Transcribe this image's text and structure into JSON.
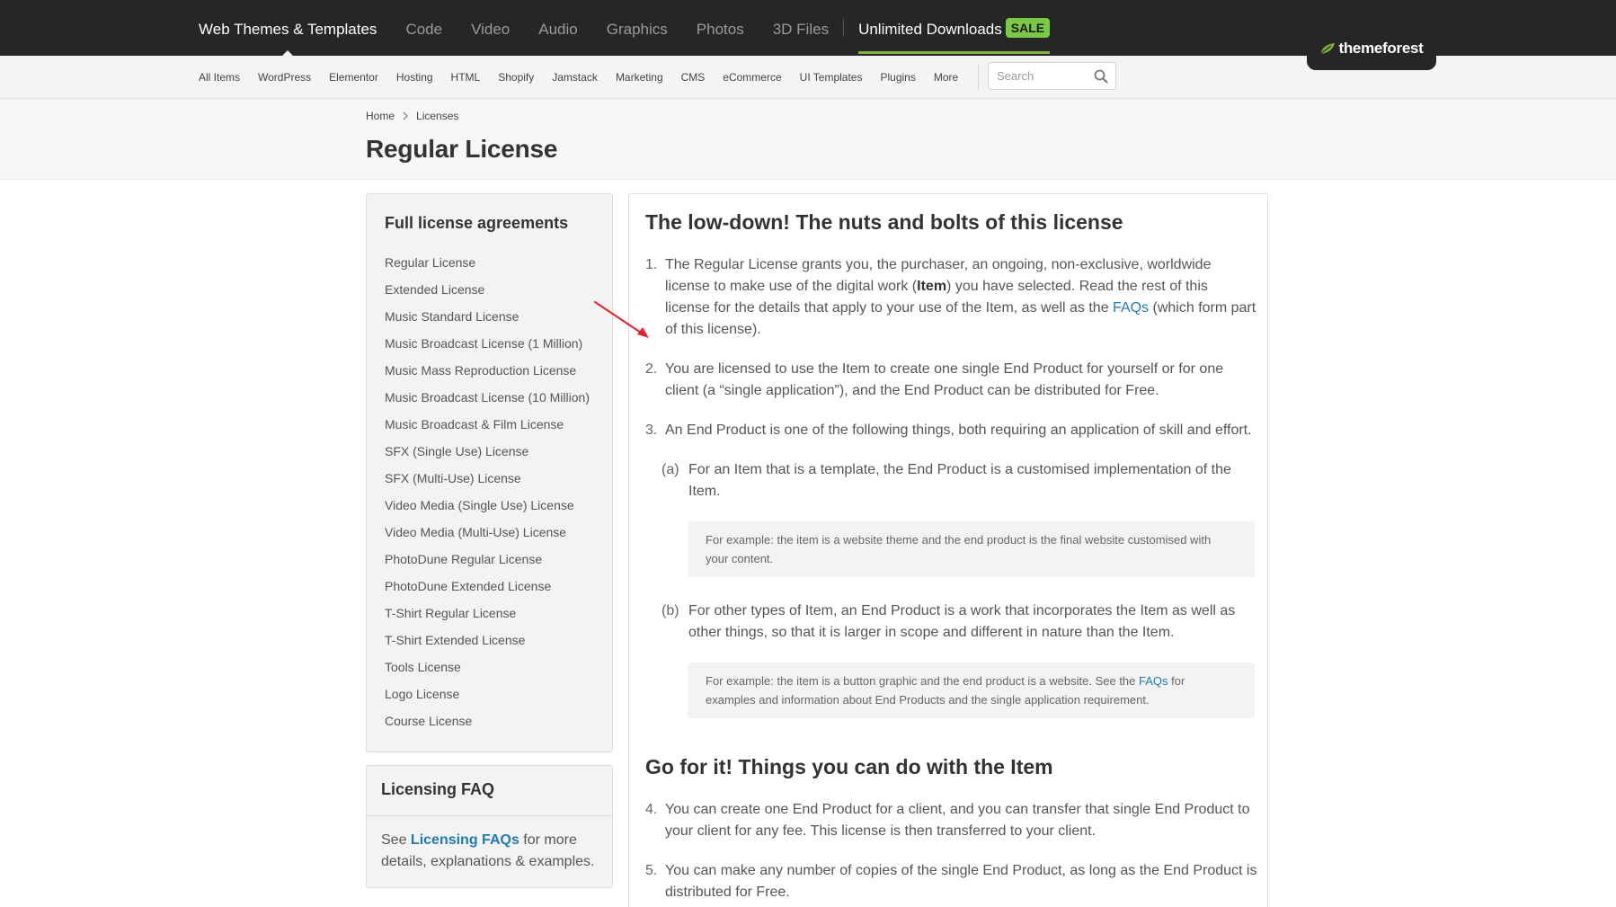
{
  "topnav": {
    "items": [
      {
        "label": "Web Themes & Templates"
      },
      {
        "label": "Code"
      },
      {
        "label": "Video"
      },
      {
        "label": "Audio"
      },
      {
        "label": "Graphics"
      },
      {
        "label": "Photos"
      },
      {
        "label": "3D Files"
      }
    ],
    "unlimited_label": "Unlimited Downloads",
    "sale_badge": "SALE",
    "logo_text": "themeforest",
    "accent_color": "#82b440"
  },
  "subnav": {
    "items": [
      {
        "label": "All Items"
      },
      {
        "label": "WordPress"
      },
      {
        "label": "Elementor"
      },
      {
        "label": "Hosting"
      },
      {
        "label": "HTML"
      },
      {
        "label": "Shopify"
      },
      {
        "label": "Jamstack"
      },
      {
        "label": "Marketing"
      },
      {
        "label": "CMS"
      },
      {
        "label": "eCommerce"
      },
      {
        "label": "UI Templates"
      },
      {
        "label": "Plugins"
      },
      {
        "label": "More"
      }
    ],
    "search_placeholder": "Search"
  },
  "breadcrumb": {
    "home": "Home",
    "current": "Licenses"
  },
  "page_title": "Regular License",
  "sidebar": {
    "title": "Full license agreements",
    "items": [
      {
        "label": "Regular License"
      },
      {
        "label": "Extended License"
      },
      {
        "label": "Music Standard License"
      },
      {
        "label": "Music Broadcast License (1 Million)"
      },
      {
        "label": "Music Mass Reproduction License"
      },
      {
        "label": "Music Broadcast License (10 Million)"
      },
      {
        "label": "Music Broadcast & Film License"
      },
      {
        "label": "SFX (Single Use) License"
      },
      {
        "label": "SFX (Multi-Use) License"
      },
      {
        "label": "Video Media (Single Use) License"
      },
      {
        "label": "Video Media (Multi-Use) License"
      },
      {
        "label": "PhotoDune Regular License"
      },
      {
        "label": "PhotoDune Extended License"
      },
      {
        "label": "T-Shirt Regular License"
      },
      {
        "label": "T-Shirt Extended License"
      },
      {
        "label": "Tools License"
      },
      {
        "label": "Logo License"
      },
      {
        "label": "Course License"
      }
    ]
  },
  "faq": {
    "title": "Licensing FAQ",
    "pre": "See ",
    "link": "Licensing FAQs",
    "post": " for more details, explanations & examples."
  },
  "main": {
    "heading1": "The low-down! The nuts and bolts of this license",
    "item1": {
      "num": "1.",
      "text_a": "The Regular License grants you, the purchaser, an ongoing, non-exclusive, worldwide license to make use of the digital work (",
      "bold": "Item",
      "text_b": ") you have selected. Read the rest of this license for the details that apply to your use of the Item, as well as the ",
      "link": "FAQs",
      "text_c": " (which form part of this license)."
    },
    "item2": {
      "num": "2.",
      "text": "You are licensed to use the Item to create one single End Product for yourself or for one client (a “single application”), and the End Product can be distributed for Free."
    },
    "item3": {
      "num": "3.",
      "text": "An End Product is one of the following things, both requiring an application of skill and effort."
    },
    "item3a": {
      "num": "(a)",
      "text": "For an Item that is a template, the End Product is a customised implementation of the Item."
    },
    "example_a": "For example: the item is a website theme and the end product is the final website customised with your content.",
    "item3b": {
      "num": "(b)",
      "text": "For other types of Item, an End Product is a work that incorporates the Item as well as other things, so that it is larger in scope and different in nature than the Item."
    },
    "example_b": {
      "pre": "For example: the item is a button graphic and the end product is a website. See the ",
      "link": "FAQs",
      "post": " for examples and information about End Products and the single application requirement."
    },
    "heading2": "Go for it! Things you can do with the Item",
    "item4": {
      "num": "4.",
      "text": "You can create one End Product for a client, and you can transfer that single End Product to your client for any fee. This license is then transferred to your client."
    },
    "item5": {
      "num": "5.",
      "text": "You can make any number of copies of the single End Product, as long as the End Product is distributed for Free."
    }
  }
}
